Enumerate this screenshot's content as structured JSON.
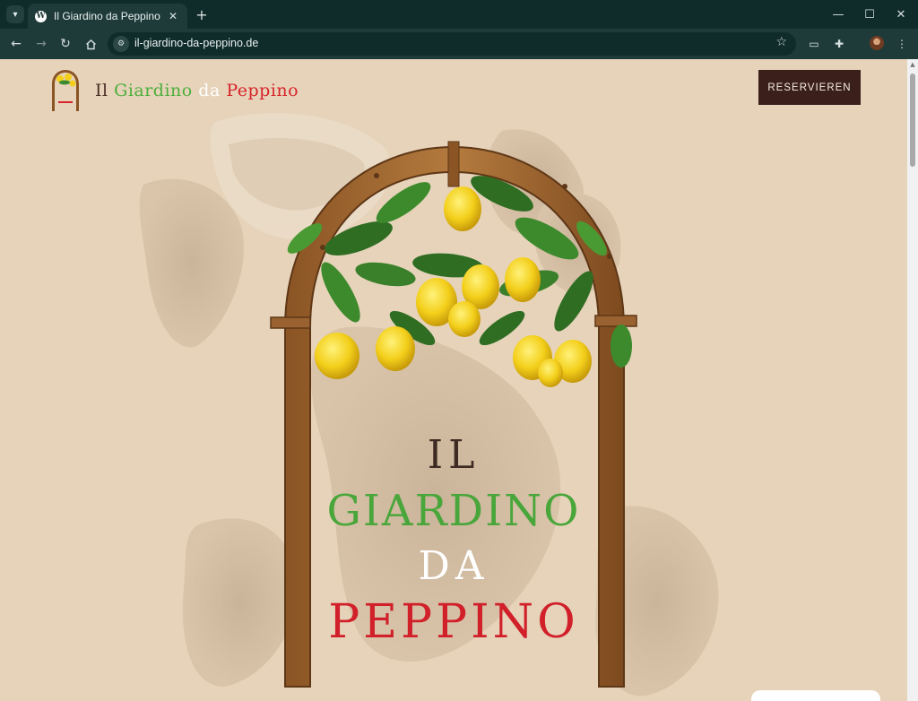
{
  "browser": {
    "tab": {
      "title": "Il Giardino da Peppino",
      "favicon": "wordpress-icon"
    },
    "address": {
      "url": "il-giardino-da-peppino.de"
    },
    "icons": {
      "tab_search": "chevron-down-icon",
      "back": "back-arrow-icon",
      "forward": "forward-arrow-icon",
      "reload": "reload-icon",
      "home": "home-icon",
      "site_info": "site-info-icon",
      "bookmark": "star-icon",
      "cast": "cast-icon",
      "extensions": "puzzle-icon",
      "menu": "kebab-menu-icon"
    },
    "window_controls": [
      "minimize",
      "maximize",
      "close"
    ]
  },
  "header": {
    "brand": {
      "il": "Il",
      "giardino": "Giardino",
      "da": "da",
      "peppino": "Peppino"
    },
    "reserve_label": "RESERVIEREN"
  },
  "hero": {
    "title": {
      "il": "IL",
      "giardino": "GIARDINO",
      "da": "DA",
      "peppino": "PEPPINO"
    }
  },
  "colors": {
    "page_background": "#e6d3ba",
    "brown": "#3b1f1b",
    "green": "#4caf3c",
    "white": "#ffffff",
    "red": "#d8232a",
    "chrome": "#1e3b39"
  }
}
